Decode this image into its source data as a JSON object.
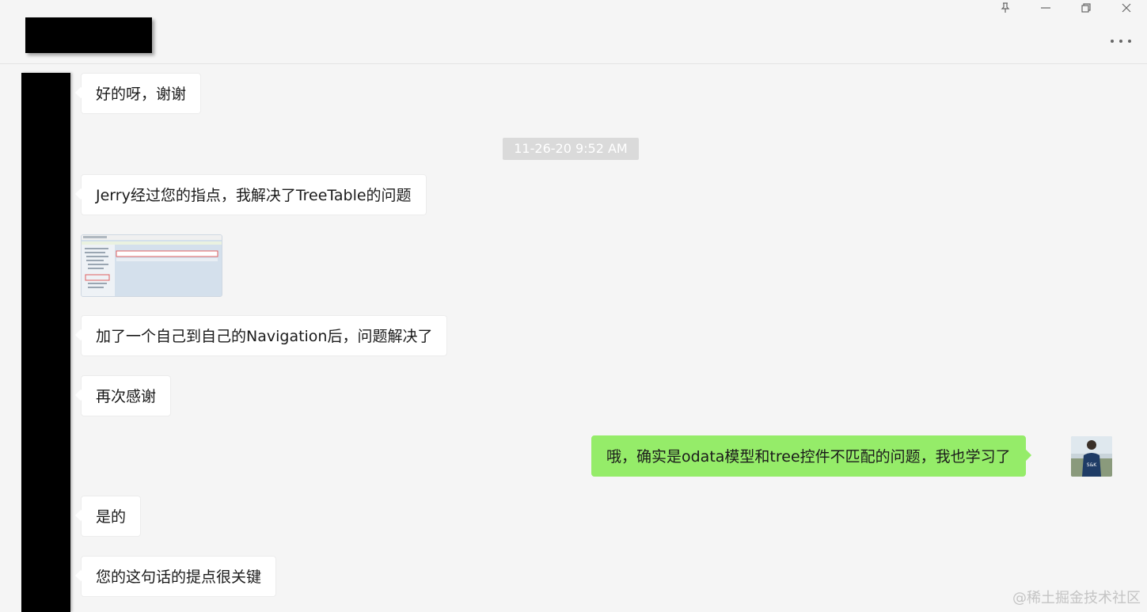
{
  "window": {
    "pin_icon": "pin-icon",
    "minimize_icon": "minimize-icon",
    "restore_icon": "restore-icon",
    "close_icon": "close-icon",
    "more_icon": "more-icon"
  },
  "timestamp": "11-26-20 9:52 AM",
  "messages": [
    {
      "side": "left",
      "text": "好的呀，谢谢"
    },
    {
      "side": "left",
      "text": "Jerry经过您的指点，我解决了TreeTable的问题"
    },
    {
      "side": "left",
      "type": "image",
      "icon": "screenshot-thumbnail"
    },
    {
      "side": "left",
      "text": "加了一个自己到自己的Navigation后，问题解决了"
    },
    {
      "side": "left",
      "text": "再次感谢"
    },
    {
      "side": "right",
      "text": "哦，确实是odata模型和tree控件不匹配的问题，我也学习了"
    },
    {
      "side": "left",
      "text": "是的"
    },
    {
      "side": "left",
      "text": "您的这句话的提点很关键"
    }
  ],
  "watermark": "@稀土掘金技术社区",
  "colors": {
    "background": "#f5f5f5",
    "incoming_bubble": "#ffffff",
    "outgoing_bubble": "#95ec69",
    "timestamp_bg": "#dadada"
  }
}
